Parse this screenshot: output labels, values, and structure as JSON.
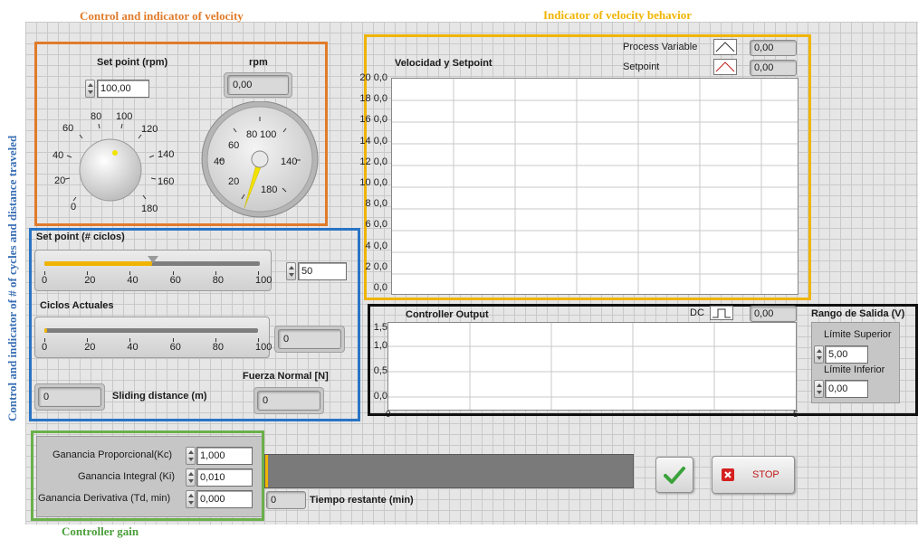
{
  "captions": {
    "velocity_control": "Control and indicator of velocity",
    "velocity_behavior": "Indicator of velocity behavior",
    "cycles_distance": "Control and indicator of # of cycles and distance traveled",
    "controller_gain": "Controller gain"
  },
  "velocity": {
    "setpoint_label": "Set point (rpm)",
    "setpoint_value": "100,00",
    "rpm_label": "rpm",
    "rpm_value": "0,00",
    "knob_scale": [
      "0",
      "20",
      "40",
      "60",
      "80",
      "100",
      "120",
      "140",
      "160",
      "180"
    ],
    "gauge_scale": [
      "20",
      "40",
      "60",
      "80",
      "100",
      "140",
      "180"
    ]
  },
  "velocity_chart": {
    "title": "Velocidad y Setpoint",
    "legend": [
      {
        "name": "Process Variable",
        "value": "0,00"
      },
      {
        "name": "Setpoint",
        "value": "0,00"
      }
    ],
    "y_ticks": [
      "20 0,0",
      "18 0,0",
      "16 0,0",
      "14 0,0",
      "12 0,0",
      "10 0,0",
      "8 0,0",
      "6 0,0",
      "4 0,0",
      "2 0,0",
      "0,0"
    ]
  },
  "cycles": {
    "setpoint_label": "Set point (# ciclos)",
    "setpoint_value": "50",
    "slider_scale": [
      "0",
      "20",
      "40",
      "60",
      "80",
      "100"
    ],
    "current_label": "Ciclos Actuales",
    "current_value": "0",
    "normal_force_label": "Fuerza Normal [N]",
    "normal_force_value": "0",
    "sliding_distance_label": "Sliding distance (m)",
    "sliding_distance_value": "0"
  },
  "controller_output": {
    "title": "Controller Output",
    "legend_name": "DC",
    "legend_value": "0,00",
    "y_ticks": [
      "1,5",
      "1,0",
      "0,5",
      "0,0"
    ],
    "x_ticks": [
      "0",
      "5"
    ],
    "range_title": "Rango de Salida (V)",
    "upper_label": "Límite Superior",
    "upper_value": "5,00",
    "lower_label": "Límite Inferior",
    "lower_value": "0,00"
  },
  "gains": {
    "kc_label": "Ganancia Proporcional(Kc)",
    "kc_value": "1,000",
    "ki_label": "Ganancia Integral (Ki)",
    "ki_value": "0,010",
    "td_label": "Ganancia Derivativa (Td, min)",
    "td_value": "0,000"
  },
  "progress": {
    "time_value": "0",
    "time_label": "Tiempo restante (min)",
    "fraction": 0.0
  },
  "buttons": {
    "ok_icon": "checkmark-icon",
    "stop_label": "STOP"
  },
  "colors": {
    "accent_yellow": "#f0b400",
    "stop_red": "#d42020",
    "ok_green": "#3aa23a"
  }
}
